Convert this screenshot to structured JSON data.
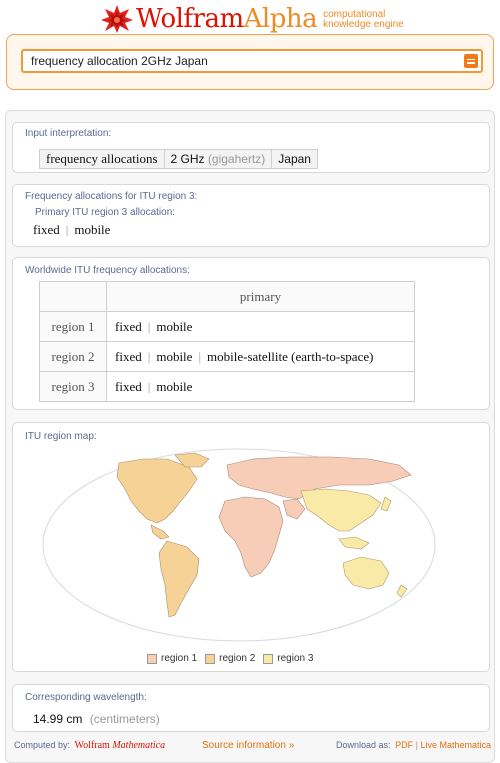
{
  "header": {
    "brand_part1": "Wolfram",
    "brand_part2": "Alpha",
    "tagline_line1": "computational",
    "tagline_line2": "knowledge engine",
    "colors": {
      "brand_red": "#dd1100",
      "brand_orange": "#f08a24"
    }
  },
  "search": {
    "value": "frequency allocation 2GHz Japan",
    "go_icon": "equals-icon"
  },
  "pods": {
    "input": {
      "title": "Input interpretation:",
      "cells": [
        "frequency allocations",
        "2 GHz",
        "(gigahertz)",
        "Japan"
      ]
    },
    "itu3": {
      "title": "Frequency allocations for ITU region 3:",
      "subtitle": "Primary ITU region 3 allocation:",
      "values": [
        "fixed",
        "mobile"
      ]
    },
    "worldwide": {
      "title": "Worldwide ITU frequency allocations:",
      "column_header": "primary",
      "rows": [
        {
          "label": "region 1",
          "values": [
            "fixed",
            "mobile"
          ]
        },
        {
          "label": "region 2",
          "values": [
            "fixed",
            "mobile",
            "mobile-satellite (earth-to-space)"
          ]
        },
        {
          "label": "region 3",
          "values": [
            "fixed",
            "mobile"
          ]
        }
      ]
    },
    "map": {
      "title": "ITU region map:",
      "legend": [
        {
          "label": "region 1",
          "color": "#f7cdb8"
        },
        {
          "label": "region 2",
          "color": "#f6d296"
        },
        {
          "label": "region 3",
          "color": "#faeaa8"
        }
      ]
    },
    "wavelength": {
      "title": "Corresponding wavelength:",
      "value": "14.99 cm",
      "unit": "(centimeters)"
    }
  },
  "footer": {
    "computed_by": "Computed by:",
    "engine_part1": "Wolfram",
    "engine_part2": "Mathematica",
    "source_info": "Source information »",
    "download_as": "Download as:",
    "pdf": "PDF",
    "live": "Live Mathematica"
  }
}
